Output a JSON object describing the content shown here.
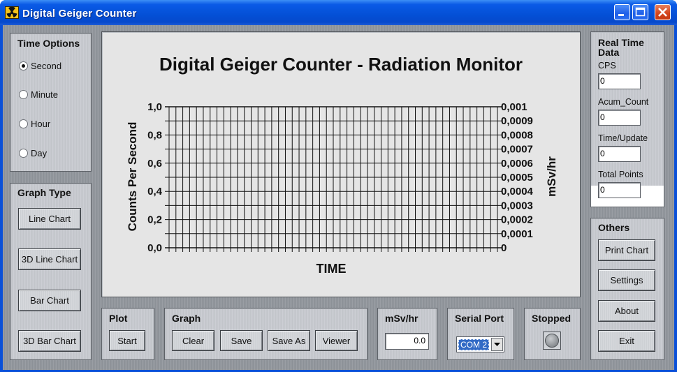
{
  "window": {
    "title": "Digital Geiger Counter"
  },
  "time_options": {
    "title": "Time Options",
    "options": [
      {
        "label": "Second",
        "selected": true
      },
      {
        "label": "Minute",
        "selected": false
      },
      {
        "label": "Hour",
        "selected": false
      },
      {
        "label": "Day",
        "selected": false
      }
    ]
  },
  "graph_type": {
    "title": "Graph Type",
    "buttons": [
      "Line Chart",
      "3D Line Chart",
      "Bar Chart",
      "3D Bar Chart"
    ]
  },
  "chart_data": {
    "type": "line",
    "title": "Digital Geiger Counter - Radiation Monitor",
    "xlabel": "TIME",
    "ylabel": "Counts Per Second",
    "y2label": "mSv/hr",
    "ylim": [
      0,
      1
    ],
    "y2lim": [
      0,
      0.001
    ],
    "yticks": [
      "0,0",
      "0,2",
      "0,4",
      "0,6",
      "0,8",
      "1,0"
    ],
    "y2ticks": [
      "0",
      "0,0001",
      "0,0002",
      "0,0003",
      "0,0004",
      "0,0005",
      "0,0006",
      "0,0007",
      "0,0008",
      "0,0009",
      "0,001"
    ],
    "grid": true,
    "series": []
  },
  "real_time": {
    "title_line1": "Real Time",
    "title_line2": "Data",
    "fields": [
      {
        "label": "CPS",
        "value": "0"
      },
      {
        "label": "Acum_Count",
        "value": "0"
      },
      {
        "label": "Time/Update",
        "value": "0"
      },
      {
        "label": "Total Points",
        "value": "0"
      }
    ]
  },
  "others": {
    "title": "Others",
    "buttons": [
      "Print Chart",
      "Settings",
      "About",
      "Exit"
    ]
  },
  "plot": {
    "title": "Plot",
    "start_label": "Start"
  },
  "graph": {
    "title": "Graph",
    "buttons": [
      "Clear",
      "Save",
      "Save As",
      "Viewer"
    ]
  },
  "msv": {
    "title": "mSv/hr",
    "value": "0.0"
  },
  "serial": {
    "title": "Serial Port",
    "selected": "COM 2"
  },
  "status": {
    "title": "Stopped",
    "led_color": "#8a8e92"
  },
  "colors": {
    "titlebar": "#0a5ae6",
    "selection": "#316ac5"
  }
}
